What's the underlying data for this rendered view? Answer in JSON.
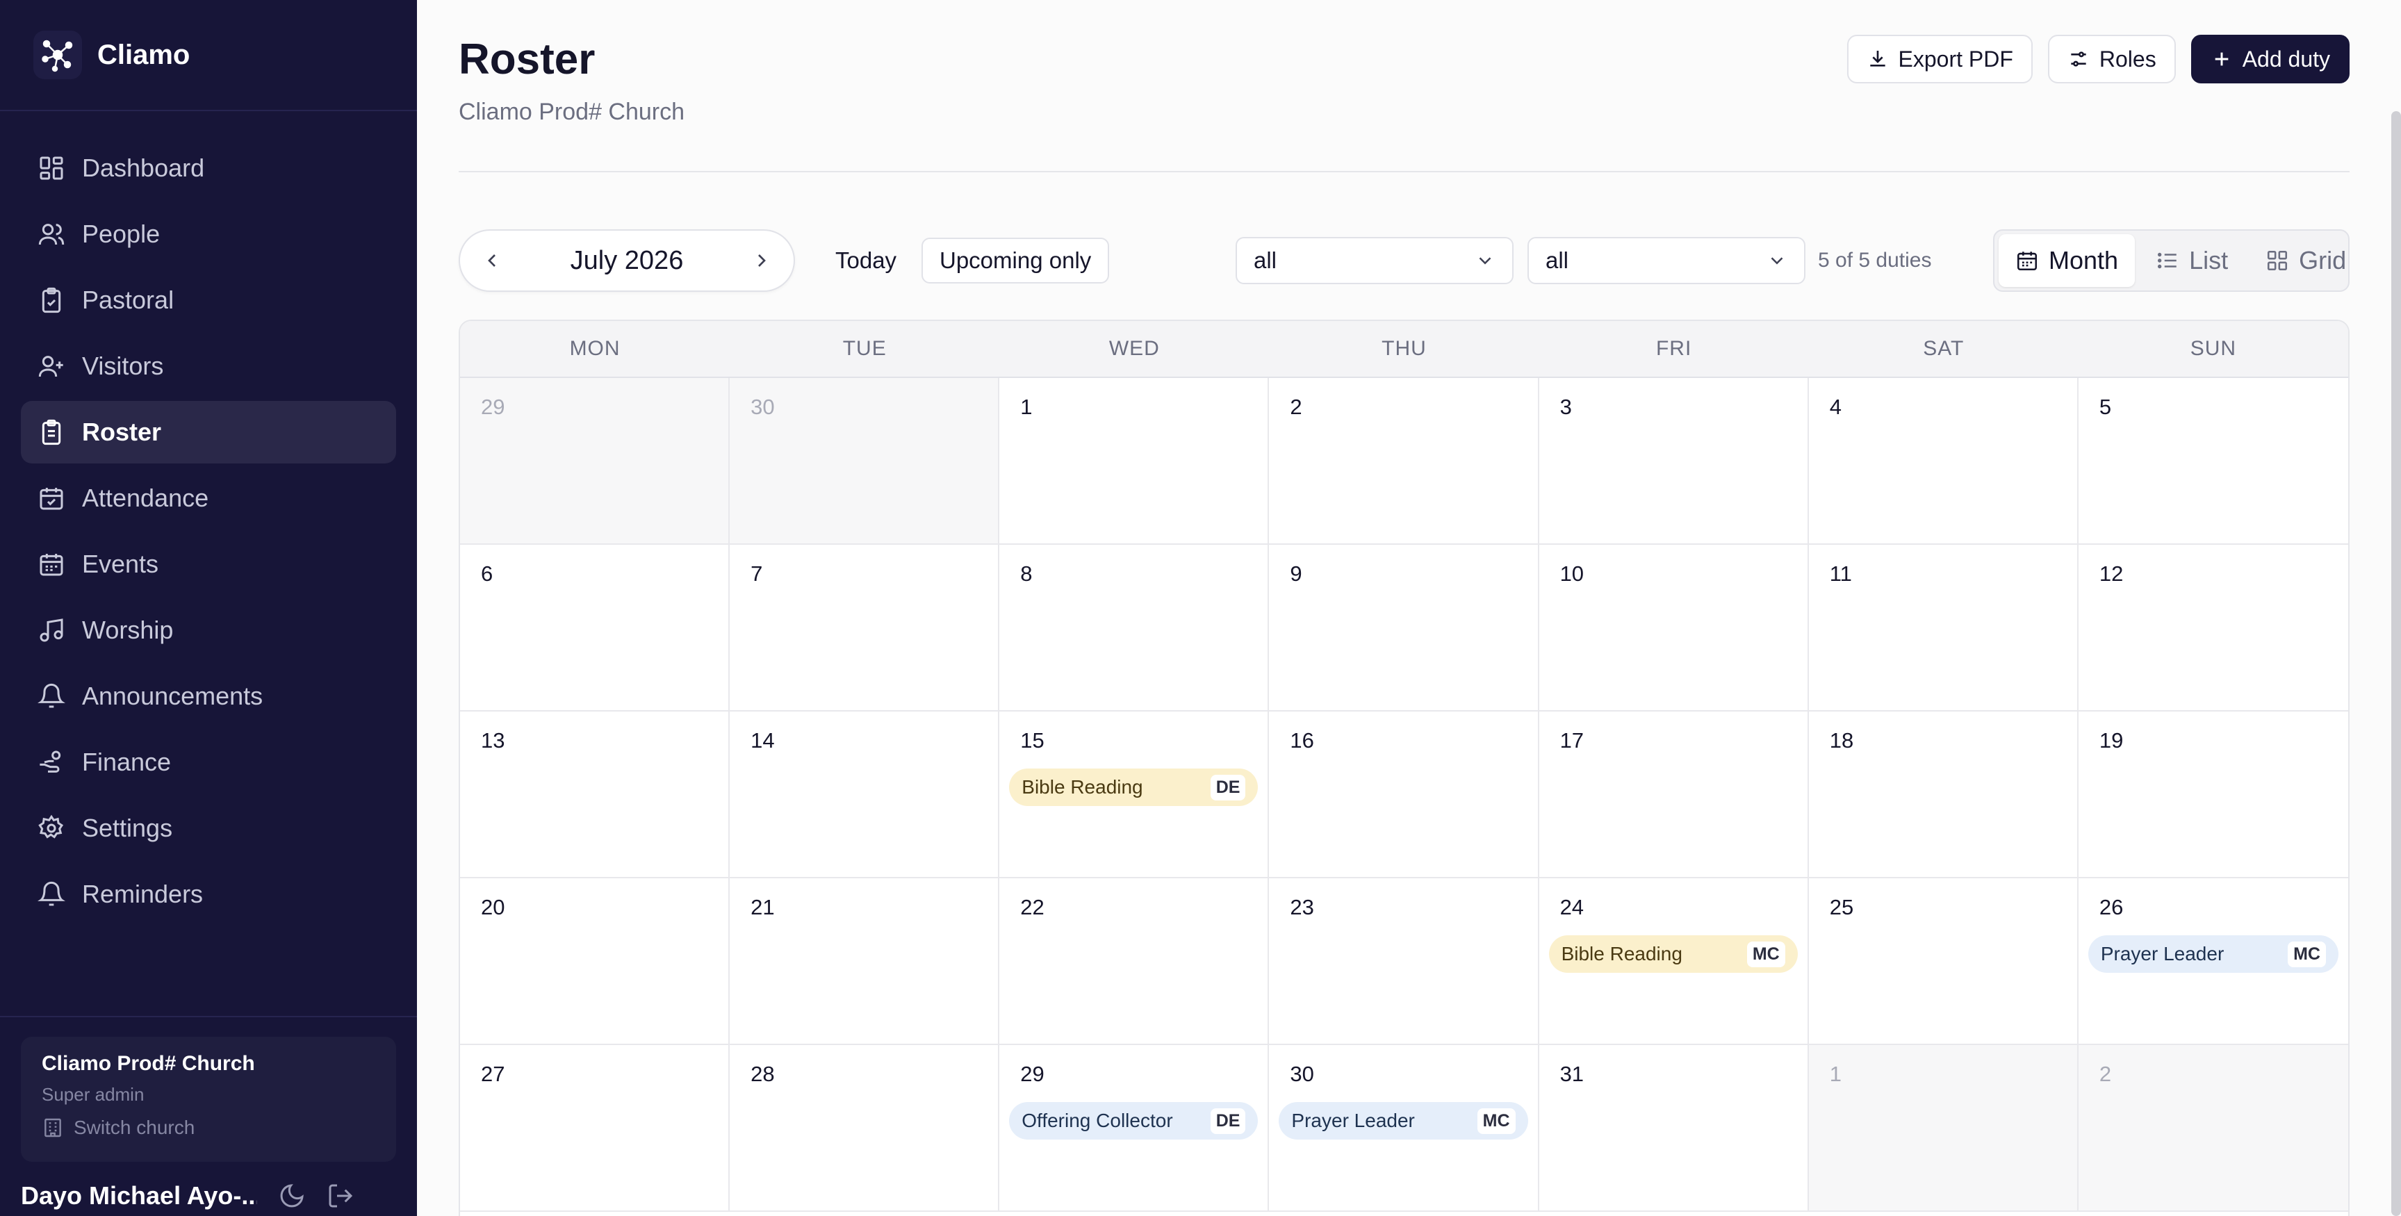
{
  "app": {
    "name": "Cliamo"
  },
  "sidebar": {
    "items": [
      {
        "label": "Dashboard",
        "icon": "dashboard-icon",
        "active": false
      },
      {
        "label": "People",
        "icon": "people-icon",
        "active": false
      },
      {
        "label": "Pastoral",
        "icon": "clipboard-check-icon",
        "active": false
      },
      {
        "label": "Visitors",
        "icon": "user-plus-icon",
        "active": false
      },
      {
        "label": "Roster",
        "icon": "clipboard-list-icon",
        "active": true
      },
      {
        "label": "Attendance",
        "icon": "calendar-check-icon",
        "active": false
      },
      {
        "label": "Events",
        "icon": "calendar-icon",
        "active": false
      },
      {
        "label": "Worship",
        "icon": "music-note-icon",
        "active": false
      },
      {
        "label": "Announcements",
        "icon": "bell-icon",
        "active": false
      },
      {
        "label": "Finance",
        "icon": "hand-coins-icon",
        "active": false
      },
      {
        "label": "Settings",
        "icon": "gear-icon",
        "active": false
      },
      {
        "label": "Reminders",
        "icon": "bell-icon",
        "active": false
      }
    ],
    "church": {
      "name": "Cliamo Prod# Church",
      "role": "Super admin",
      "switch_label": "Switch church"
    },
    "user": {
      "name": "Dayo Michael Ayo-..."
    }
  },
  "header": {
    "title": "Roster",
    "subtitle": "Cliamo Prod# Church",
    "export_label": "Export PDF",
    "roles_label": "Roles",
    "add_label": "Add duty"
  },
  "toolbar": {
    "month_label": "July 2026",
    "today_label": "Today",
    "upcoming_label": "Upcoming only",
    "filter1_value": "all",
    "filter2_value": "all",
    "duty_count": "5 of 5 duties",
    "views": [
      {
        "label": "Month",
        "icon": "calendar-icon",
        "active": true
      },
      {
        "label": "List",
        "icon": "list-icon",
        "active": false
      },
      {
        "label": "Grid",
        "icon": "grid-icon",
        "active": false
      }
    ]
  },
  "calendar": {
    "weekdays": [
      "MON",
      "TUE",
      "WED",
      "THU",
      "FRI",
      "SAT",
      "SUN"
    ],
    "weeks": [
      [
        {
          "day": "29",
          "outside": true,
          "events": []
        },
        {
          "day": "30",
          "outside": true,
          "events": []
        },
        {
          "day": "1",
          "outside": false,
          "events": []
        },
        {
          "day": "2",
          "outside": false,
          "events": []
        },
        {
          "day": "3",
          "outside": false,
          "events": []
        },
        {
          "day": "4",
          "outside": false,
          "events": []
        },
        {
          "day": "5",
          "outside": false,
          "events": []
        }
      ],
      [
        {
          "day": "6",
          "outside": false,
          "events": []
        },
        {
          "day": "7",
          "outside": false,
          "events": []
        },
        {
          "day": "8",
          "outside": false,
          "events": []
        },
        {
          "day": "9",
          "outside": false,
          "events": []
        },
        {
          "day": "10",
          "outside": false,
          "events": []
        },
        {
          "day": "11",
          "outside": false,
          "events": []
        },
        {
          "day": "12",
          "outside": false,
          "events": []
        }
      ],
      [
        {
          "day": "13",
          "outside": false,
          "events": []
        },
        {
          "day": "14",
          "outside": false,
          "events": []
        },
        {
          "day": "15",
          "outside": false,
          "events": [
            {
              "title": "Bible Reading",
              "initials": "DE",
              "color": "amber"
            }
          ]
        },
        {
          "day": "16",
          "outside": false,
          "events": []
        },
        {
          "day": "17",
          "outside": false,
          "events": []
        },
        {
          "day": "18",
          "outside": false,
          "events": []
        },
        {
          "day": "19",
          "outside": false,
          "events": []
        }
      ],
      [
        {
          "day": "20",
          "outside": false,
          "events": []
        },
        {
          "day": "21",
          "outside": false,
          "events": []
        },
        {
          "day": "22",
          "outside": false,
          "events": []
        },
        {
          "day": "23",
          "outside": false,
          "events": []
        },
        {
          "day": "24",
          "outside": false,
          "events": [
            {
              "title": "Bible Reading",
              "initials": "MC",
              "color": "amber"
            }
          ]
        },
        {
          "day": "25",
          "outside": false,
          "events": []
        },
        {
          "day": "26",
          "outside": false,
          "events": [
            {
              "title": "Prayer Leader",
              "initials": "MC",
              "color": "blue"
            }
          ]
        }
      ],
      [
        {
          "day": "27",
          "outside": false,
          "events": []
        },
        {
          "day": "28",
          "outside": false,
          "events": []
        },
        {
          "day": "29",
          "outside": false,
          "events": [
            {
              "title": "Offering Collector",
              "initials": "DE",
              "color": "blue"
            }
          ]
        },
        {
          "day": "30",
          "outside": false,
          "events": [
            {
              "title": "Prayer Leader",
              "initials": "MC",
              "color": "blue"
            }
          ]
        },
        {
          "day": "31",
          "outside": false,
          "events": []
        },
        {
          "day": "1",
          "outside": true,
          "events": []
        },
        {
          "day": "2",
          "outside": true,
          "events": []
        }
      ]
    ]
  },
  "colors": {
    "sidebar_bg": "#171538",
    "primary": "#171538",
    "amber_event": "#fbf0cc",
    "blue_event": "#e5eefa"
  }
}
